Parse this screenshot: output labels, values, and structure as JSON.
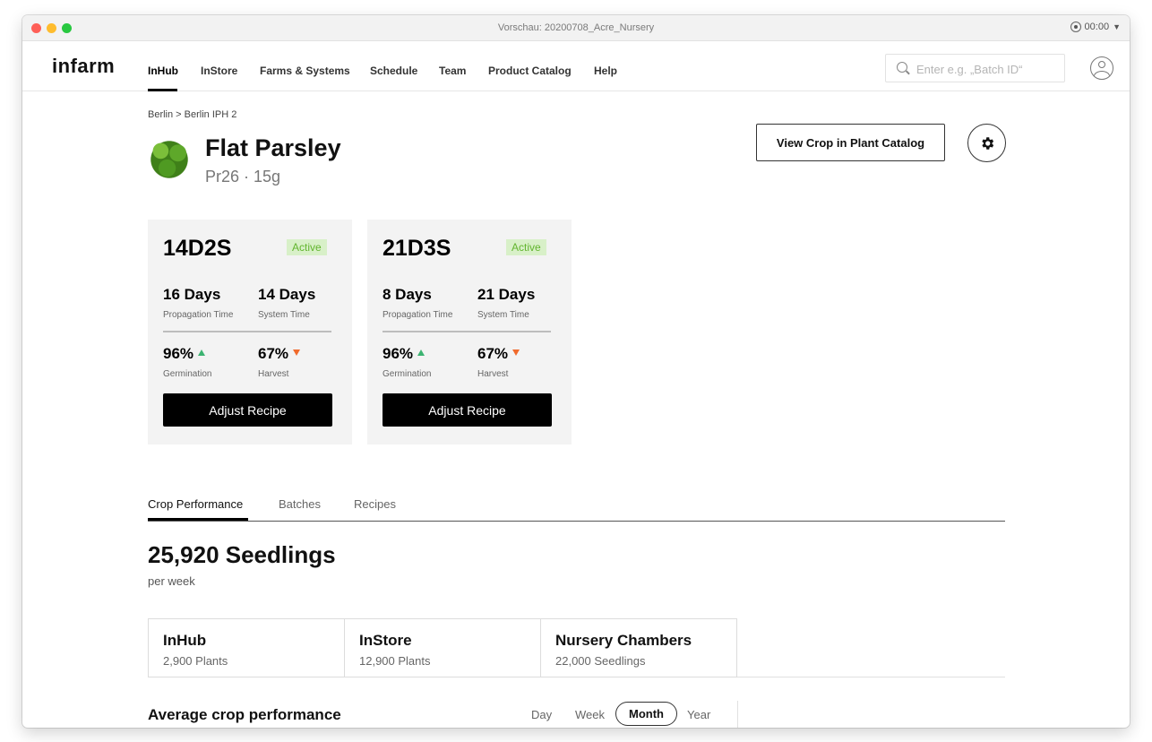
{
  "window": {
    "title": "Vorschau: 20200708_Acre_Nursery",
    "recording_time": "00:00"
  },
  "nav": {
    "logo": "infarm",
    "items": [
      "InHub",
      "InStore",
      "Farms & Systems",
      "Schedule",
      "Team",
      "Product Catalog",
      "Help"
    ],
    "active": "InHub",
    "search_placeholder": "Enter e.g. „Batch ID“"
  },
  "breadcrumb": "Berlin > Berlin IPH 2",
  "crop": {
    "name": "Flat Parsley",
    "subtitle": "Pr26 · 15g",
    "view_button": "View Crop in Plant Catalog"
  },
  "recipes": [
    {
      "code": "14D2S",
      "status": "Active",
      "propagation_value": "16 Days",
      "propagation_label": "Propagation Time",
      "system_value": "14 Days",
      "system_label": "System Time",
      "germination_value": "96%",
      "germination_label": "Germination",
      "harvest_value": "67%",
      "harvest_label": "Harvest",
      "button": "Adjust Recipe"
    },
    {
      "code": "21D3S",
      "status": "Active",
      "propagation_value": "8 Days",
      "propagation_label": "Propagation Time",
      "system_value": "21 Days",
      "system_label": "System Time",
      "germination_value": "96%",
      "germination_label": "Germination",
      "harvest_value": "67%",
      "harvest_label": "Harvest",
      "button": "Adjust Recipe"
    }
  ],
  "tabs": [
    "Crop Performance",
    "Batches",
    "Recipes"
  ],
  "active_tab": "Crop Performance",
  "seedlings": {
    "value": "25,920 Seedlings",
    "per": "per week"
  },
  "locations": [
    {
      "title": "InHub",
      "sub": "2,900 Plants"
    },
    {
      "title": "InStore",
      "sub": "12,900 Plants"
    },
    {
      "title": "Nursery Chambers",
      "sub": "22,000 Seedlings"
    }
  ],
  "average": {
    "title": "Average crop performance",
    "periods": [
      "Day",
      "Week",
      "Month",
      "Year"
    ],
    "active_period": "Month"
  },
  "colors": {
    "active_badge_bg": "#d8f0c8",
    "active_badge_text": "#62b52e",
    "up_arrow": "#3cb371",
    "down_arrow": "#f06a2c"
  }
}
